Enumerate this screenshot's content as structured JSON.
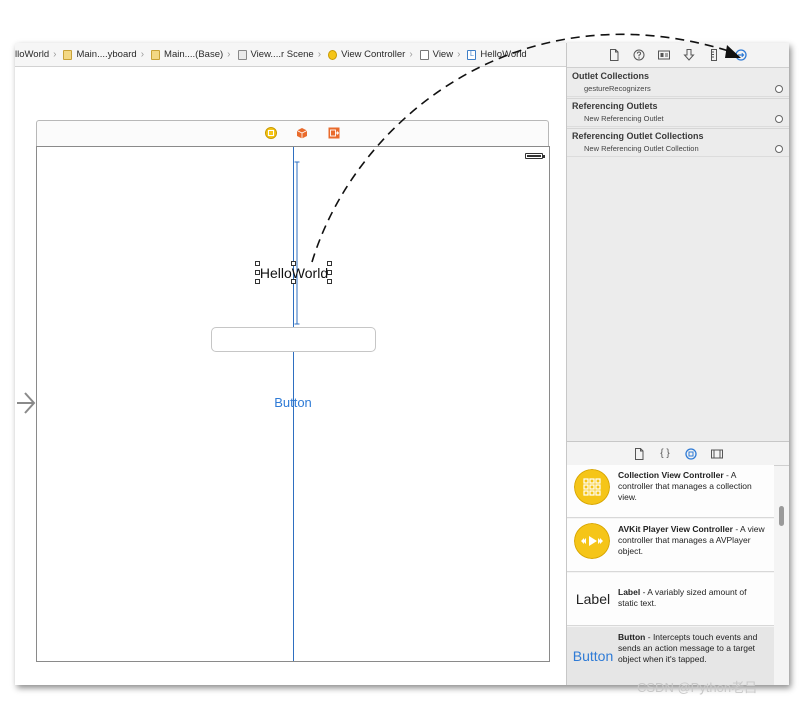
{
  "breadcrumb": [
    {
      "label": "lloWorld",
      "icon": "folder-icon"
    },
    {
      "label": "Main....yboard",
      "icon": "storyboard-file-icon"
    },
    {
      "label": "Main....(Base)",
      "icon": "storyboard-file-icon"
    },
    {
      "label": "View....r Scene",
      "icon": "scene-icon"
    },
    {
      "label": "View Controller",
      "icon": "view-controller-icon"
    },
    {
      "label": "View",
      "icon": "view-icon"
    },
    {
      "label": "HelloWorld",
      "icon": "label-icon"
    }
  ],
  "canvas": {
    "label_text": "HelloWorld",
    "textfield_value": "",
    "button_text": "Button"
  },
  "inspector": {
    "sections": [
      {
        "title": "Outlet Collections",
        "rows": [
          "gestureRecognizers"
        ]
      },
      {
        "title": "Referencing Outlets",
        "rows": [
          "New Referencing Outlet"
        ]
      },
      {
        "title": "Referencing Outlet Collections",
        "rows": [
          "New Referencing Outlet Collection"
        ]
      }
    ],
    "tabs": [
      "file-inspector-icon",
      "quick-help-icon",
      "identity-inspector-icon",
      "attributes-inspector-icon",
      "size-inspector-icon",
      "connections-inspector-icon"
    ]
  },
  "library": {
    "tabs": [
      "file-template-icon",
      "code-snippet-icon",
      "object-library-icon",
      "media-library-icon"
    ],
    "items": [
      {
        "icon_word": "",
        "title": "Collection View Controller",
        "desc": " - A controller that manages a collection view."
      },
      {
        "icon_word": "",
        "title": "AVKit Player View Controller",
        "desc": " - A view controller that manages a AVPlayer object."
      },
      {
        "icon_word": "Label",
        "title": "Label",
        "desc": " - A variably sized amount of static text."
      },
      {
        "icon_word": "Button",
        "title": "Button",
        "desc": " - Intercepts touch events and sends an action message to a target object when it's tapped."
      }
    ]
  },
  "watermark": "CSDN @Python老吕",
  "colors": {
    "accent": "#2f7bd6",
    "yellow": "#f5c518",
    "orange": "#e96b2c"
  }
}
